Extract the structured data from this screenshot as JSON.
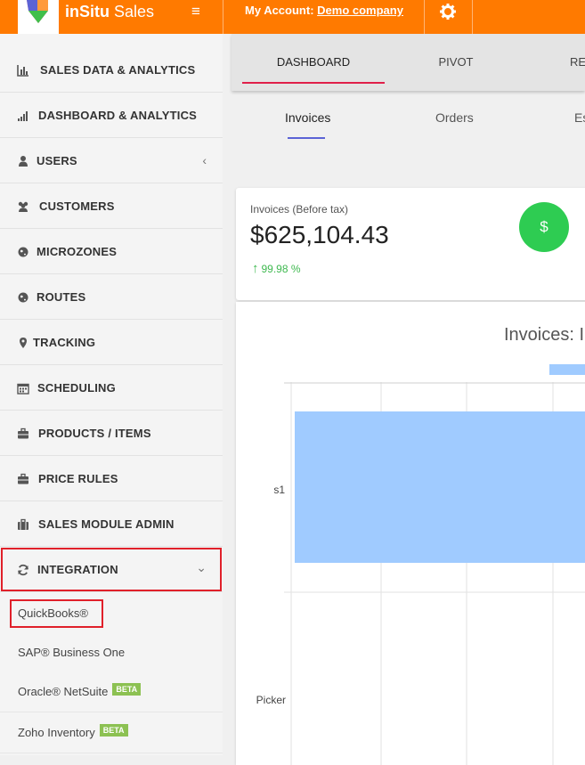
{
  "header": {
    "brand_bold": "inSitu",
    "brand_rest": " Sales",
    "account_label": "My Account:",
    "account_company": "Demo company",
    "menu_glyph": "≡",
    "accent_color": "#ff7a00"
  },
  "sidebar": {
    "items": [
      {
        "label": "SALES DATA & ANALYTICS",
        "icon": "bar-chart-icon"
      },
      {
        "label": "DASHBOARD & ANALYTICS",
        "icon": "signal-bars-icon"
      },
      {
        "label": "USERS",
        "icon": "user-icon",
        "arrow": "‹"
      },
      {
        "label": "CUSTOMERS",
        "icon": "users-group-icon"
      },
      {
        "label": "MICROZONES",
        "icon": "globe-icon"
      },
      {
        "label": "ROUTES",
        "icon": "globe-icon"
      },
      {
        "label": "TRACKING",
        "icon": "map-marker-icon"
      },
      {
        "label": "SCHEDULING",
        "icon": "calendar-icon"
      },
      {
        "label": "PRODUCTS / ITEMS",
        "icon": "briefcase-icon"
      },
      {
        "label": "PRICE RULES",
        "icon": "briefcase-icon"
      },
      {
        "label": "SALES MODULE ADMIN",
        "icon": "suitcase-icon"
      },
      {
        "label": "INTEGRATION",
        "icon": "refresh-icon",
        "arrow": "⌄"
      }
    ],
    "subitems": [
      {
        "label": "QuickBooks®",
        "beta": ""
      },
      {
        "label": "SAP® Business One",
        "beta": ""
      },
      {
        "label": "Oracle® NetSuite",
        "beta": "BETA"
      },
      {
        "label": "Zoho Inventory",
        "beta": "BETA"
      }
    ]
  },
  "main": {
    "tabs": [
      {
        "label": "DASHBOARD"
      },
      {
        "label": "PIVOT"
      },
      {
        "label": "RE"
      }
    ],
    "subtabs": [
      {
        "label": "Invoices"
      },
      {
        "label": "Orders"
      },
      {
        "label": "Es"
      }
    ],
    "kpi": {
      "label": "Invoices (Before tax)",
      "value": "$625,104.43",
      "delta": "99.98 %",
      "icon_glyph": "$"
    }
  },
  "chart_data": {
    "type": "bar",
    "orientation": "horizontal",
    "title": "Invoices: I",
    "categories": [
      "s1",
      "Picker"
    ],
    "series": [
      {
        "values": [
          null,
          null
        ],
        "color": "#a0cbff"
      }
    ],
    "grid": true
  }
}
